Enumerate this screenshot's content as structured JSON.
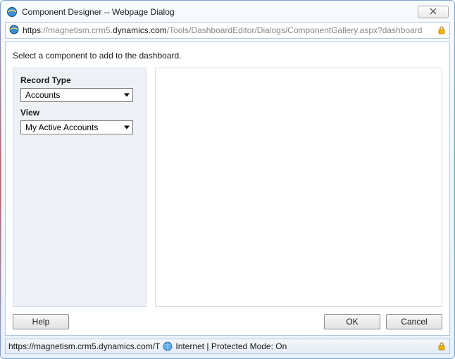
{
  "window": {
    "title": "Component Designer -- Webpage Dialog"
  },
  "address": {
    "scheme": "https",
    "host_prefix": "://magnetism.crm5.",
    "host_highlight": "dynamics.com",
    "path": "/Tools/DashboardEditor/Dialogs/ComponentGallery.aspx?dashboard"
  },
  "dialog": {
    "instruction": "Select a component to add to the dashboard.",
    "record_type_label": "Record Type",
    "record_type_value": "Accounts",
    "view_label": "View",
    "view_value": "My Active Accounts",
    "help_label": "Help",
    "ok_label": "OK",
    "cancel_label": "Cancel"
  },
  "status": {
    "url": "https://magnetism.crm5.dynamics.com/T",
    "zone": "Internet | Protected Mode: On"
  }
}
